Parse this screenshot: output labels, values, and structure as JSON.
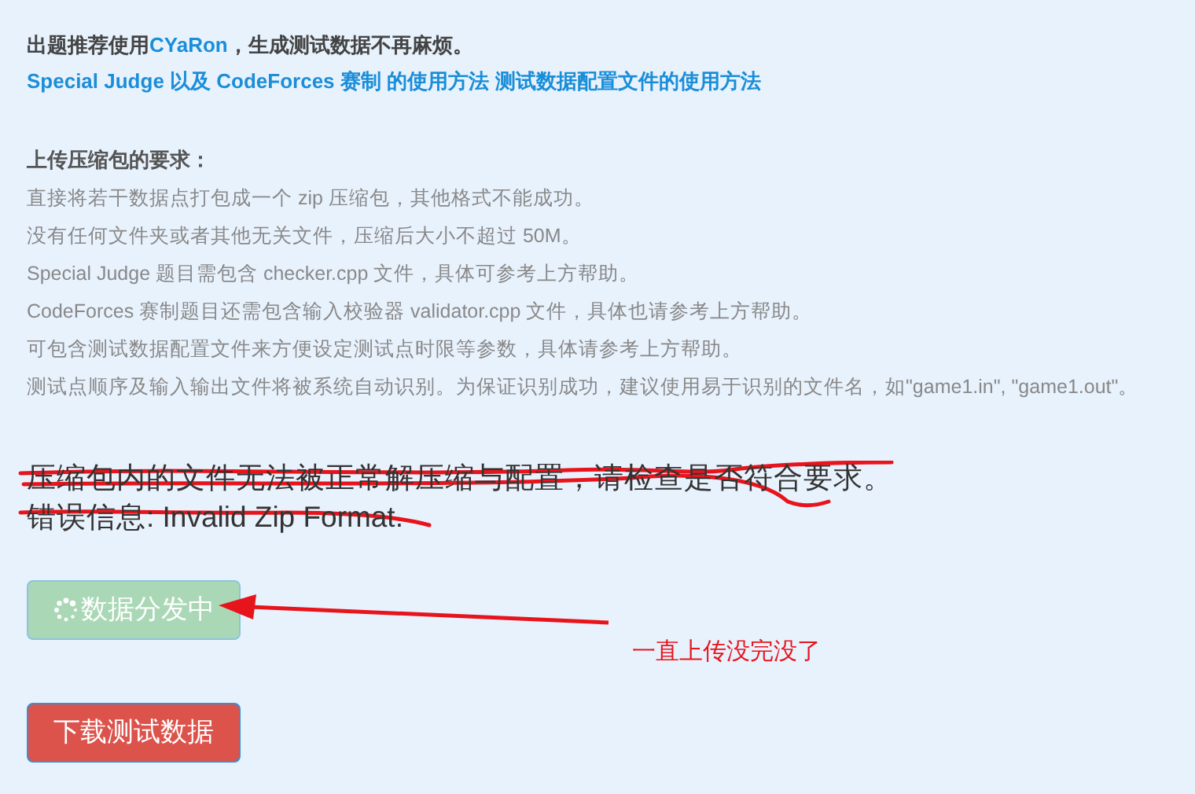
{
  "intro": {
    "before": "出题推荐使用",
    "link": "CYaRon",
    "after": "，生成测试数据不再麻烦。"
  },
  "help_links": [
    "Special Judge 以及 CodeForces 赛制 的使用方法",
    "测试数据配置文件的使用方法"
  ],
  "requirements": {
    "heading": "上传压缩包的要求：",
    "items": [
      "直接将若干数据点打包成一个 zip 压缩包，其他格式不能成功。",
      "没有任何文件夹或者其他无关文件，压缩后大小不超过 50M。",
      "Special Judge 题目需包含 checker.cpp 文件，具体可参考上方帮助。",
      "CodeForces 赛制题目还需包含输入校验器 validator.cpp 文件，具体也请参考上方帮助。",
      "可包含测试数据配置文件来方便设定测试点时限等参数，具体请参考上方帮助。",
      "测试点顺序及输入输出文件将被系统自动识别。为保证识别成功，建议使用易于识别的文件名，如\"game1.in\", \"game1.out\"。"
    ]
  },
  "errors": [
    {
      "text": "压缩包内的文件无法被正常解压缩与配置，请检查是否符合要求。",
      "scribbled": true
    },
    {
      "text": "错误信息: Invalid Zip Format.",
      "scribbled": true
    }
  ],
  "upload_button": {
    "label": "数据分发中",
    "loading": true
  },
  "annotation": {
    "text": "一直上传没完没了"
  },
  "download_button": {
    "label": "下载测试数据"
  }
}
